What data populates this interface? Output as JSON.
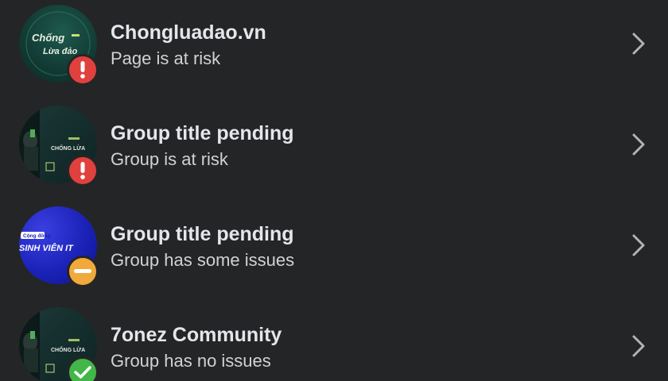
{
  "items": [
    {
      "title": "Chongluadao.vn",
      "subtitle": "Page is at risk",
      "status": "at-risk",
      "avatar_text_line1": "Chống",
      "avatar_text_line2": "Lừa đảo"
    },
    {
      "title": "Group title pending",
      "subtitle": "Group is at risk",
      "status": "at-risk",
      "avatar_text": "CHỐNG LỪA"
    },
    {
      "title": "Group title pending",
      "subtitle": "Group has some issues",
      "status": "some-issues",
      "avatar_tag": "Cộng đồng",
      "avatar_text": "SINH VIÊN IT"
    },
    {
      "title": "7onez Community",
      "subtitle": "Group has no issues",
      "status": "no-issues",
      "avatar_text": "CHỐNG LỪA"
    }
  ],
  "colors": {
    "background": "#242526",
    "risk": "#e0413e",
    "issues": "#f1a93b",
    "ok": "#42b649",
    "text_primary": "#e4e6eb",
    "text_secondary": "#d0d2d6"
  },
  "icons": {
    "risk": "exclamation-icon",
    "issues": "minus-icon",
    "ok": "checkmark-icon",
    "chevron": "chevron-right-icon"
  }
}
